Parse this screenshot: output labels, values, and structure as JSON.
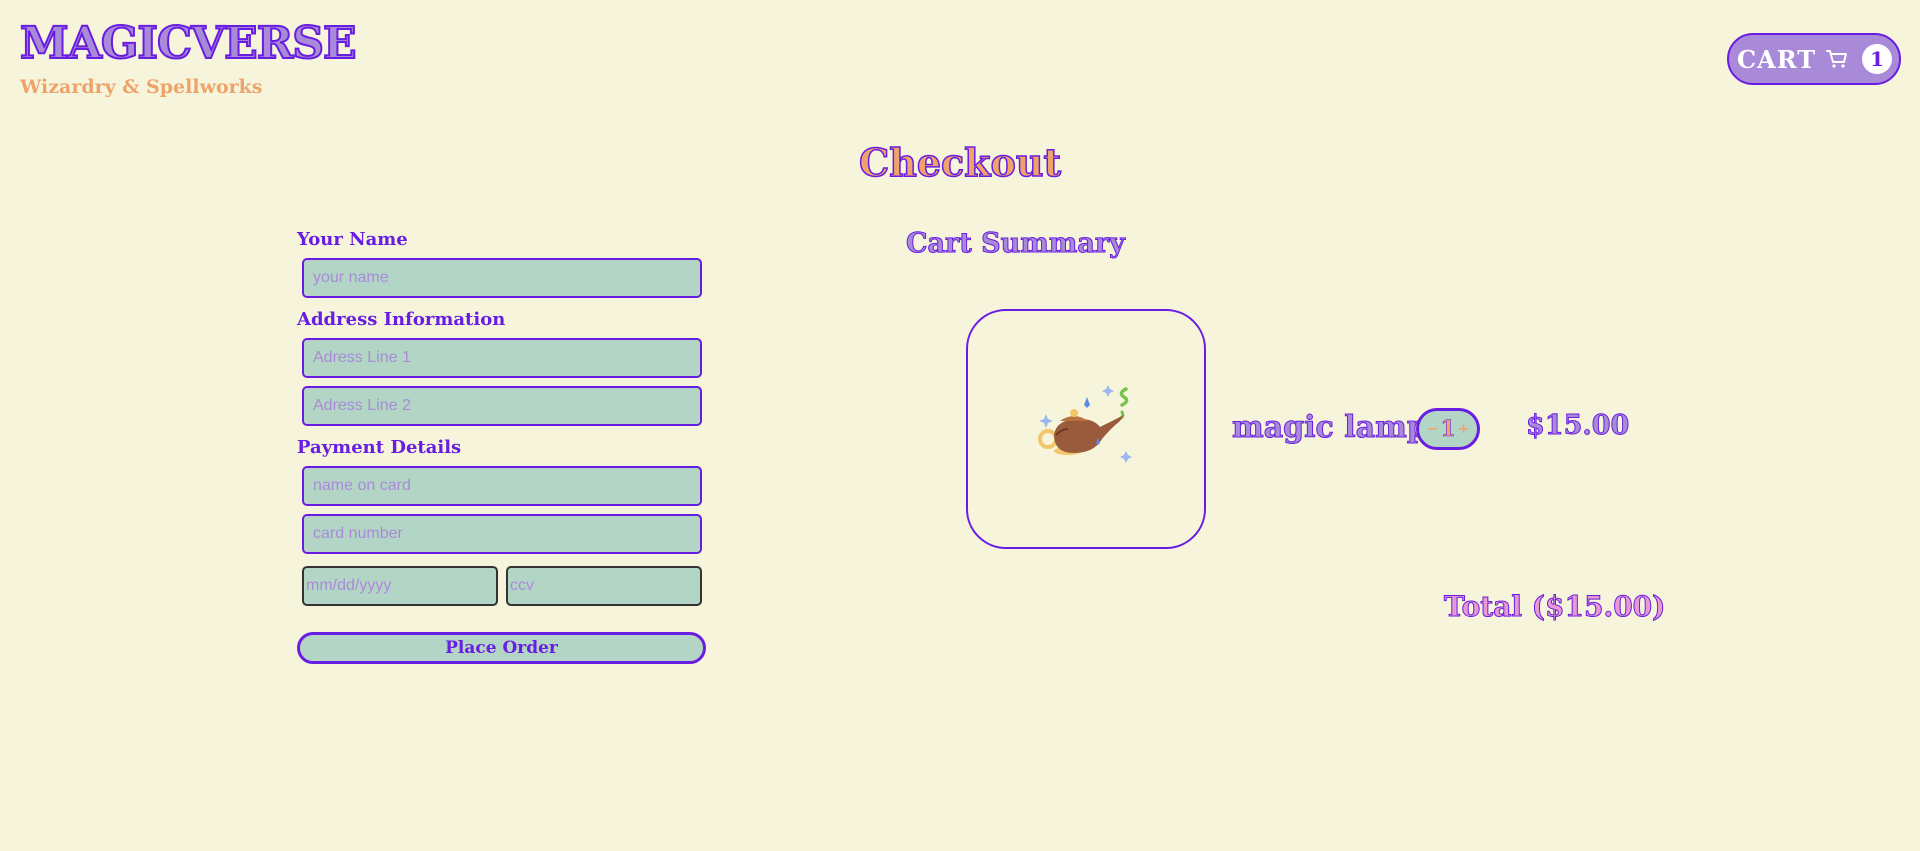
{
  "brand": {
    "logo": "MAGICVERSE",
    "tagline": "Wizardry & Spellworks"
  },
  "header": {
    "cart_label": "CART",
    "cart_count": "1",
    "cart_icon": "shopping-cart-icon"
  },
  "page": {
    "title": "Checkout"
  },
  "form": {
    "name_section": "Your Name",
    "name_placeholder": "your name",
    "address_section": "Address Information",
    "address1_placeholder": "Adress Line 1",
    "address2_placeholder": "Adress Line 2",
    "payment_section": "Payment Details",
    "card_name_placeholder": "name on card",
    "card_number_placeholder": "card number",
    "expiry_placeholder": "mm/dd/yyyy",
    "ccv_placeholder": "ccv",
    "submit_label": "Place Order"
  },
  "cart_summary": {
    "title": "Cart Summary",
    "items": [
      {
        "name": "magic lamp",
        "image_icon": "magic-lamp-icon",
        "quantity": "1",
        "minus": "−",
        "plus": "+",
        "price": "$15.00"
      }
    ],
    "total": "Total ($15.00)"
  },
  "colors": {
    "background": "#f6f5dc",
    "accent_purple": "#6a1de2",
    "lavender": "#a98ad8",
    "orange": "#eea36a",
    "mint": "#b3d5c6",
    "pink": "#e79ad2"
  }
}
